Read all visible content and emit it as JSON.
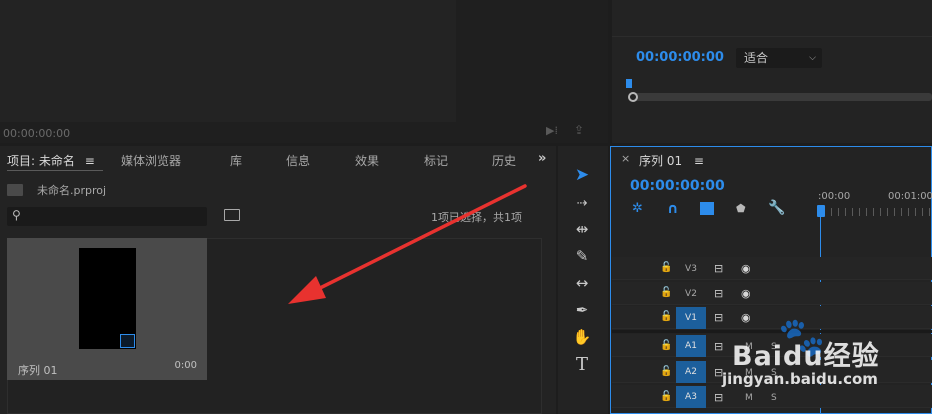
{
  "source_monitor": {
    "timecode": "00:00:00:00"
  },
  "program_monitor": {
    "timecode": "00:00:00:00",
    "fit_select": "适合"
  },
  "project_panel": {
    "tabs": [
      {
        "label": "项目: 未命名"
      },
      {
        "label": "媒体浏览器"
      },
      {
        "label": "库"
      },
      {
        "label": "信息"
      },
      {
        "label": "效果"
      },
      {
        "label": "标记"
      },
      {
        "label": "历史"
      }
    ],
    "file_name": "未命名.prproj",
    "search_placeholder": "",
    "selection_info": "1项已选择，共1项",
    "clip": {
      "name": "序列 01",
      "duration": "0:00"
    }
  },
  "timeline": {
    "sequence_tab": "序列 01",
    "close_glyph": "×",
    "timecode": "00:00:00:00",
    "ruler": [
      ":00:00",
      "00:01:00"
    ],
    "video_tracks": [
      "V3",
      "V2",
      "V1"
    ],
    "audio_tracks": [
      "A1",
      "A2",
      "A3"
    ],
    "mute_label": "M",
    "solo_label": "S"
  },
  "watermark": {
    "brand": "Baidu经验",
    "url": "jingyan.baidu.com"
  },
  "colors": {
    "accent": "#2d8ceb",
    "annotation_arrow": "#e8322f",
    "track_active": "#1c5f9c"
  }
}
